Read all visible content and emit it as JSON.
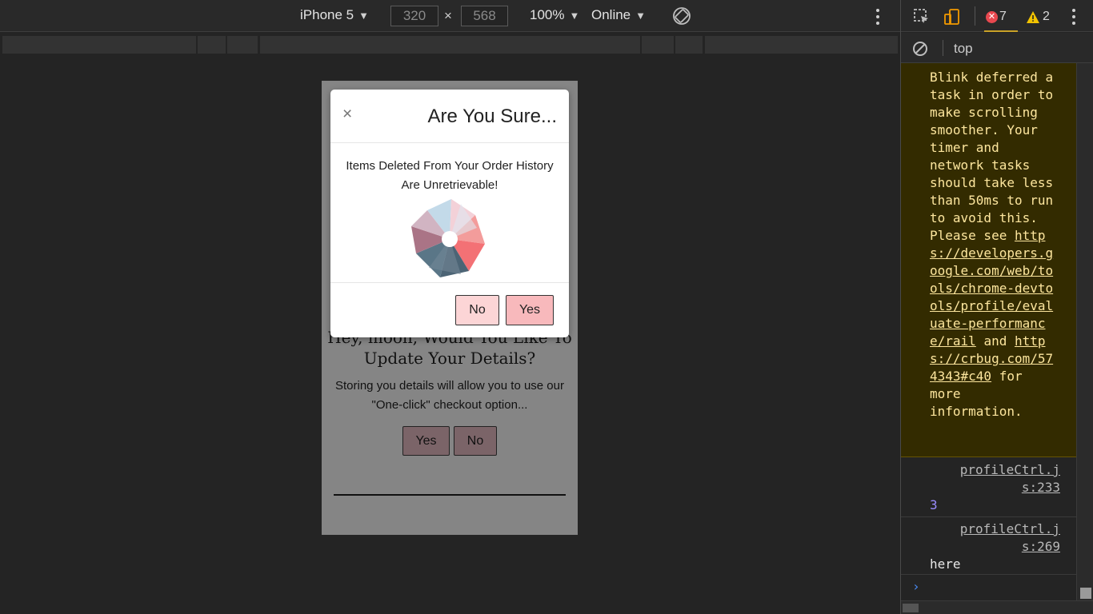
{
  "device_toolbar": {
    "device": "iPhone 5",
    "width": "320",
    "height": "568",
    "times": "×",
    "zoom": "100%",
    "throttle": "Online"
  },
  "page": {
    "heading": "Hey, moon, Would You Like To Update Your Details?",
    "text": "Storing you details will allow you to use our \"One-click\" checkout option...",
    "yes_label": "Yes",
    "no_label": "No"
  },
  "modal": {
    "close": "×",
    "title": "Are You Sure...",
    "message": "Items Deleted From Your Order History Are Unretrievable!",
    "no_label": "No",
    "yes_label": "Yes"
  },
  "devtools": {
    "error_count": "7",
    "warning_count": "2",
    "context": "top",
    "warning": {
      "text_before": "Blink deferred a task in order to make scrolling smoother. Your timer and network tasks should take less than 50ms to run to avoid this. Please see",
      "link1": "https://developers.google.com/web/tools/chrome-devtools/profile/evaluate-performance/rail",
      "and": "and",
      "link2": "https://crbug.com/574343#c40",
      "text_after": "for more information."
    },
    "logs": [
      {
        "source": "profileCtrl.js:233",
        "value": "3"
      },
      {
        "source": "profileCtrl.js:269",
        "value": "here"
      }
    ],
    "prompt": "›"
  },
  "colors": {
    "error": "#e8484f",
    "warning_bg": "#332b00",
    "warning_text": "#fde69e",
    "modal_no": "#fcd5d6",
    "modal_yes": "#f8b9bc"
  }
}
